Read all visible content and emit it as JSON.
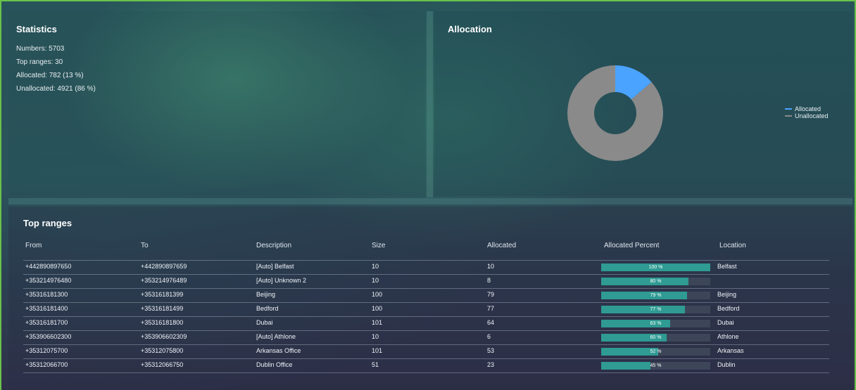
{
  "statistics": {
    "title": "Statistics",
    "numbers": "Numbers: 5703",
    "top_ranges": "Top ranges: 30",
    "allocated": "Allocated: 782 (13 %)",
    "unallocated": "Unallocated: 4921 (86 %)"
  },
  "allocation": {
    "title": "Allocation",
    "legend": [
      {
        "label": "Allocated",
        "color": "#4aa3ff"
      },
      {
        "label": "Unallocated",
        "color": "#8a8a8a"
      }
    ]
  },
  "chart_data": {
    "type": "pie",
    "donut": true,
    "title": "Allocation",
    "categories": [
      "Allocated",
      "Unallocated"
    ],
    "values": [
      782,
      4921
    ],
    "colors": [
      "#4aa3ff",
      "#8a8a8a"
    ],
    "legend_position": "right"
  },
  "top_ranges": {
    "title": "Top ranges",
    "columns": [
      "From",
      "To",
      "Description",
      "Size",
      "Allocated",
      "Allocated Percent",
      "Location"
    ],
    "rows": [
      {
        "from": "+442890897650",
        "to": "+442890897659",
        "description": "[Auto] Belfast",
        "size": "10",
        "allocated": "10",
        "percent_label": "100 %",
        "percent": 100,
        "location": "Belfast"
      },
      {
        "from": "+353214976480",
        "to": "+353214976489",
        "description": "[Auto] Unknown 2",
        "size": "10",
        "allocated": "8",
        "percent_label": "80 %",
        "percent": 80,
        "location": ""
      },
      {
        "from": "+35316181300",
        "to": "+35316181399",
        "description": "Beijing",
        "size": "100",
        "allocated": "79",
        "percent_label": "79 %",
        "percent": 79,
        "location": "Beijing"
      },
      {
        "from": "+35316181400",
        "to": "+35316181499",
        "description": "Bedford",
        "size": "100",
        "allocated": "77",
        "percent_label": "77 %",
        "percent": 77,
        "location": "Bedford"
      },
      {
        "from": "+35316181700",
        "to": "+35316181800",
        "description": "Dubai",
        "size": "101",
        "allocated": "64",
        "percent_label": "63 %",
        "percent": 63,
        "location": "Dubai"
      },
      {
        "from": "+353906602300",
        "to": "+353906602309",
        "description": "[Auto] Athlone",
        "size": "10",
        "allocated": "6",
        "percent_label": "60 %",
        "percent": 60,
        "location": "Athlone"
      },
      {
        "from": "+35312075700",
        "to": "+35312075800",
        "description": "Arkansas Office",
        "size": "101",
        "allocated": "53",
        "percent_label": "52 %",
        "percent": 52,
        "location": "Arkansas"
      },
      {
        "from": "+35312066700",
        "to": "+35312066750",
        "description": "Dublin Office",
        "size": "51",
        "allocated": "23",
        "percent_label": "45 %",
        "percent": 45,
        "location": "Dublin"
      }
    ]
  }
}
